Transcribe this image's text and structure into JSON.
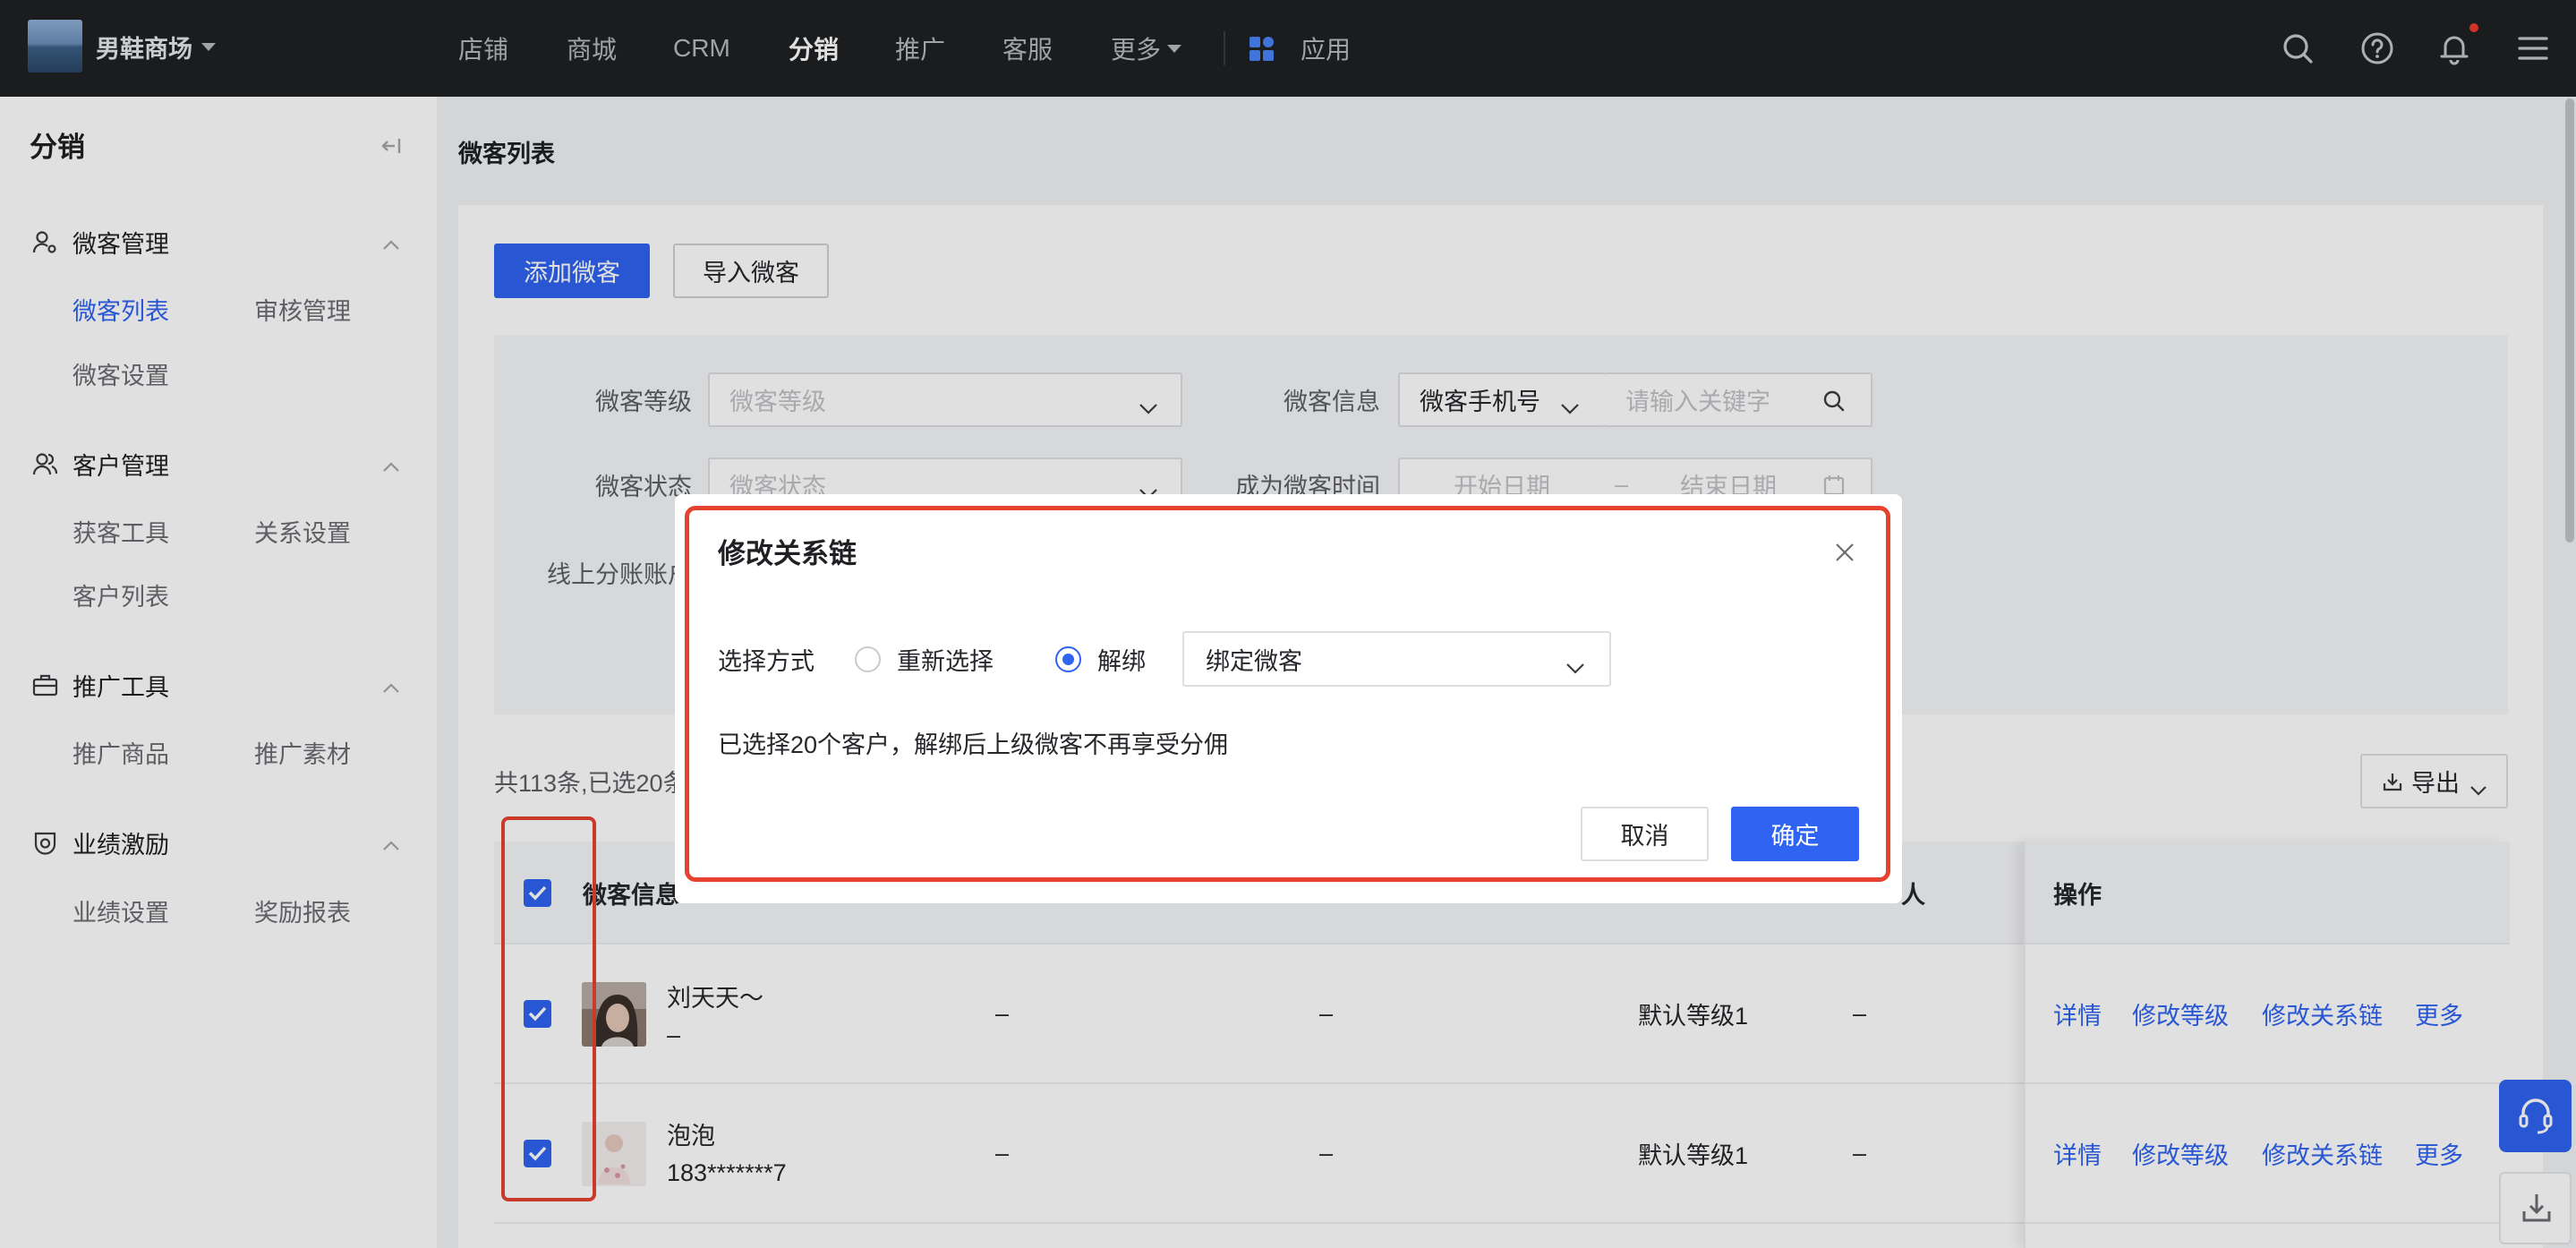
{
  "topnav": {
    "shop_name": "男鞋商场",
    "items": [
      "店铺",
      "商城",
      "CRM",
      "分销",
      "推广",
      "客服",
      "更多"
    ],
    "active": "分销",
    "apps_label": "应用",
    "icons": [
      "search-icon",
      "help-icon",
      "bell-icon",
      "menu-icon"
    ]
  },
  "sidebar": {
    "title": "分销",
    "groups": [
      {
        "label": "微客管理",
        "icon": "user-gear-icon",
        "items": [
          "微客列表",
          "审核管理",
          "微客设置"
        ]
      },
      {
        "label": "客户管理",
        "icon": "users-icon",
        "items": [
          "获客工具",
          "关系设置",
          "客户列表"
        ]
      },
      {
        "label": "推广工具",
        "icon": "toolbox-icon",
        "items": [
          "推广商品",
          "推广素材"
        ]
      },
      {
        "label": "业绩激励",
        "icon": "medal-icon",
        "items": [
          "业绩设置",
          "奖励报表"
        ]
      }
    ],
    "active_item": "微客列表"
  },
  "page": {
    "title": "微客列表",
    "buttons": {
      "add": "添加微客",
      "import": "导入微客"
    },
    "filters": {
      "level": {
        "label": "微客等级",
        "placeholder": "微客等级"
      },
      "info": {
        "label": "微客信息",
        "type_value": "微客手机号",
        "keyword_placeholder": "请输入关键字"
      },
      "status": {
        "label": "微客状态",
        "placeholder": "微客状态"
      },
      "join_time": {
        "label": "成为微客时间",
        "start_placeholder": "开始日期",
        "separator": "–",
        "end_placeholder": "结束日期"
      },
      "account": {
        "label": "线上分账账户"
      }
    },
    "summary": "共113条,已选20条",
    "export_label": "导出",
    "table": {
      "headers": {
        "info": "微客信息",
        "col5": "人",
        "actions": "操作"
      },
      "rows": [
        {
          "selected": true,
          "name": "刘天天～",
          "phone": "–",
          "c2": "–",
          "c3": "–",
          "level": "默认等级1",
          "c5": "–"
        },
        {
          "selected": true,
          "name": "泡泡",
          "phone": "183*******7",
          "c2": "–",
          "c3": "–",
          "level": "默认等级1",
          "c5": "–"
        }
      ],
      "actions": [
        "详情",
        "修改等级",
        "修改关系链",
        "更多"
      ]
    }
  },
  "modal": {
    "title": "修改关系链",
    "method_label": "选择方式",
    "options": [
      {
        "label": "重新选择",
        "checked": false
      },
      {
        "label": "解绑",
        "checked": true
      }
    ],
    "select_value": "绑定微客",
    "info": "已选择20个客户，解绑后上级微客不再享受分佣",
    "cancel": "取消",
    "confirm": "确定"
  },
  "colors": {
    "primary": "#2f64f2",
    "highlight": "#e5432f",
    "nav_bg": "#1f2023"
  }
}
